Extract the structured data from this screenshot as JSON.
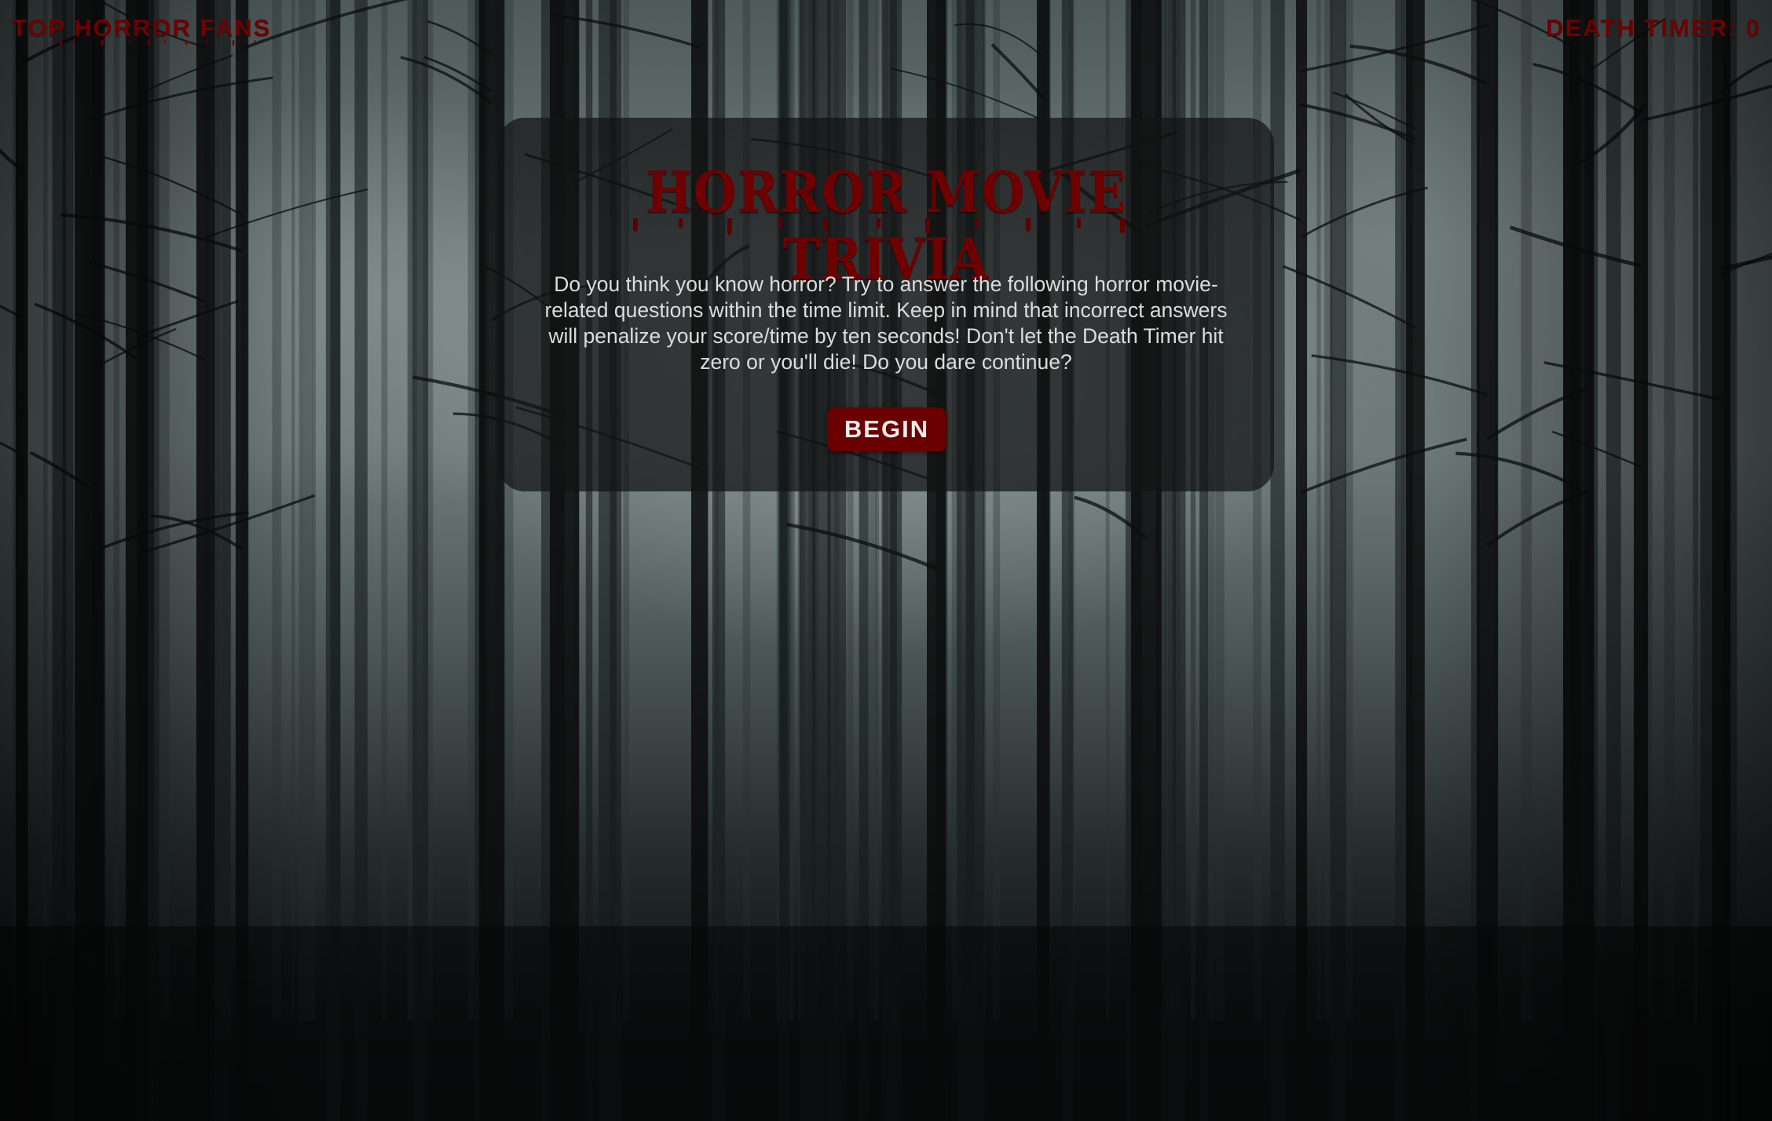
{
  "header": {
    "link_label": "TOP HORROR FANS",
    "timer_label": "DEATH TIMER: 0"
  },
  "intro": {
    "title": "HORROR MOVIE TRIVIA",
    "description": "Do you think you know horror? Try to answer the following horror movie-related questions within the time limit. Keep in mind that incorrect answers will penalize your score/time by ten seconds! Don't let the Death Timer hit zero or you'll die! Do you dare continue?",
    "begin_label": "BEGIN"
  },
  "theme": {
    "blood_red": "#6e0000",
    "button_bg": "#6a0000",
    "text_light": "#dcdcdc"
  }
}
